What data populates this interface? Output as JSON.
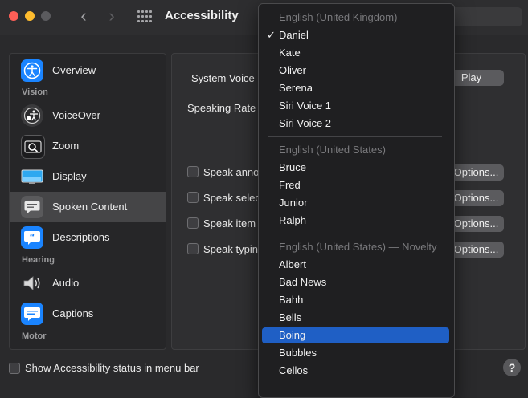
{
  "window": {
    "title": "Accessibility"
  },
  "sidebar": {
    "items": [
      {
        "label": "Overview"
      },
      {
        "label": "VoiceOver"
      },
      {
        "label": "Zoom"
      },
      {
        "label": "Display"
      },
      {
        "label": "Spoken Content",
        "selected": true
      },
      {
        "label": "Descriptions"
      },
      {
        "label": "Audio"
      },
      {
        "label": "Captions"
      }
    ],
    "sections": {
      "vision": "Vision",
      "hearing": "Hearing",
      "motor": "Motor"
    }
  },
  "main": {
    "system_voice_label": "System Voice",
    "speaking_rate_label": "Speaking Rate",
    "play_button": "Play",
    "options_label": "Options...",
    "checkboxes": [
      {
        "label": "Speak anno",
        "checked": false
      },
      {
        "label": "Speak selec",
        "checked": false
      },
      {
        "label": "Speak item",
        "checked": false
      },
      {
        "label": "Speak typin",
        "checked": false
      }
    ]
  },
  "footer": {
    "status_label": "Show Accessibility status in menu bar",
    "help": "?"
  },
  "voice_menu": {
    "groups": [
      {
        "header": "English (United Kingdom)",
        "voices": [
          "Daniel",
          "Kate",
          "Oliver",
          "Serena",
          "Siri Voice 1",
          "Siri Voice 2"
        ]
      },
      {
        "header": "English (United States)",
        "voices": [
          "Bruce",
          "Fred",
          "Junior",
          "Ralph"
        ]
      },
      {
        "header": "English (United States) — Novelty",
        "voices": [
          "Albert",
          "Bad News",
          "Bahh",
          "Bells",
          "Boing",
          "Bubbles",
          "Cellos"
        ]
      }
    ],
    "checked_voice": "Daniel",
    "highlighted_voice": "Boing",
    "checkmark": "✓"
  },
  "colors": {
    "accent": "#1f5fc5",
    "close": "#fe5f57",
    "minimize": "#febc2e"
  }
}
